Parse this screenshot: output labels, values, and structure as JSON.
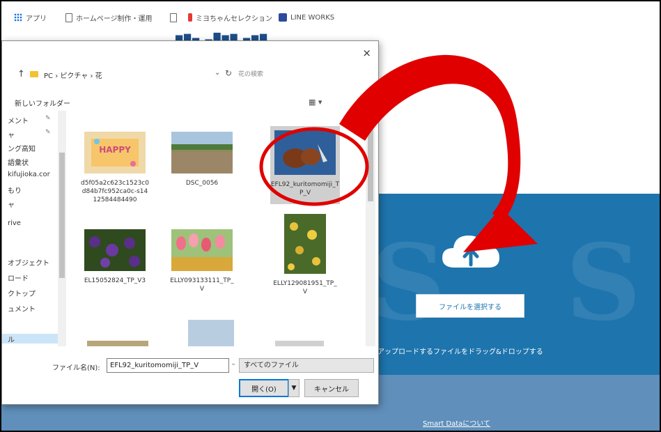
{
  "bookmarks": [
    {
      "label": "アプリ",
      "icon": "apps-grid-icon"
    },
    {
      "label": "ホームページ制作・運用",
      "icon": "page-icon"
    },
    {
      "label": "",
      "icon": "page-icon"
    },
    {
      "label": "ミヨちゃんセレクション",
      "icon": "bookmark-icon"
    },
    {
      "label": "LINE WORKS",
      "icon": "line-works-icon"
    }
  ],
  "dialog": {
    "close": "×",
    "breadcrumb": "PC › ピクチャ › 花",
    "search_placeholder": "花の検索",
    "new_folder": "新しいフォルダー",
    "sidebar": [
      "メント",
      "ャ",
      "ング高知",
      "語彙状",
      "kifujioka.cor",
      "もり",
      "ャ",
      "rive",
      "オブジェクト",
      "ロード",
      "クトップ",
      "ュメント",
      "ル"
    ],
    "files": [
      {
        "name": "d5f05a2c623c1523c0d84b7fc952ca0c-s1412584484490"
      },
      {
        "name": "DSC_0056"
      },
      {
        "name": "EFL92_kuritomomiji_TP_V"
      },
      {
        "name": "EL15052824_TP_V3"
      },
      {
        "name": "ELLY093133111_TP_V"
      },
      {
        "name": "ELLY129081951_TP_V"
      }
    ],
    "filename_label": "ファイル名(N):",
    "filename_value": "EFL92_kuritomomiji_TP_V",
    "filetype": "すべてのファイル",
    "open_label": "開く(O)",
    "cancel_label": "キャンセル"
  },
  "upload": {
    "select_button": "ファイルを選択する",
    "drop_text": "アップロードするファイルをドラッグ&ドロップする"
  },
  "footer": {
    "link": "Smart Dataについて"
  },
  "colors": {
    "accent": "#1e74ad",
    "annotation": "#e00000"
  }
}
